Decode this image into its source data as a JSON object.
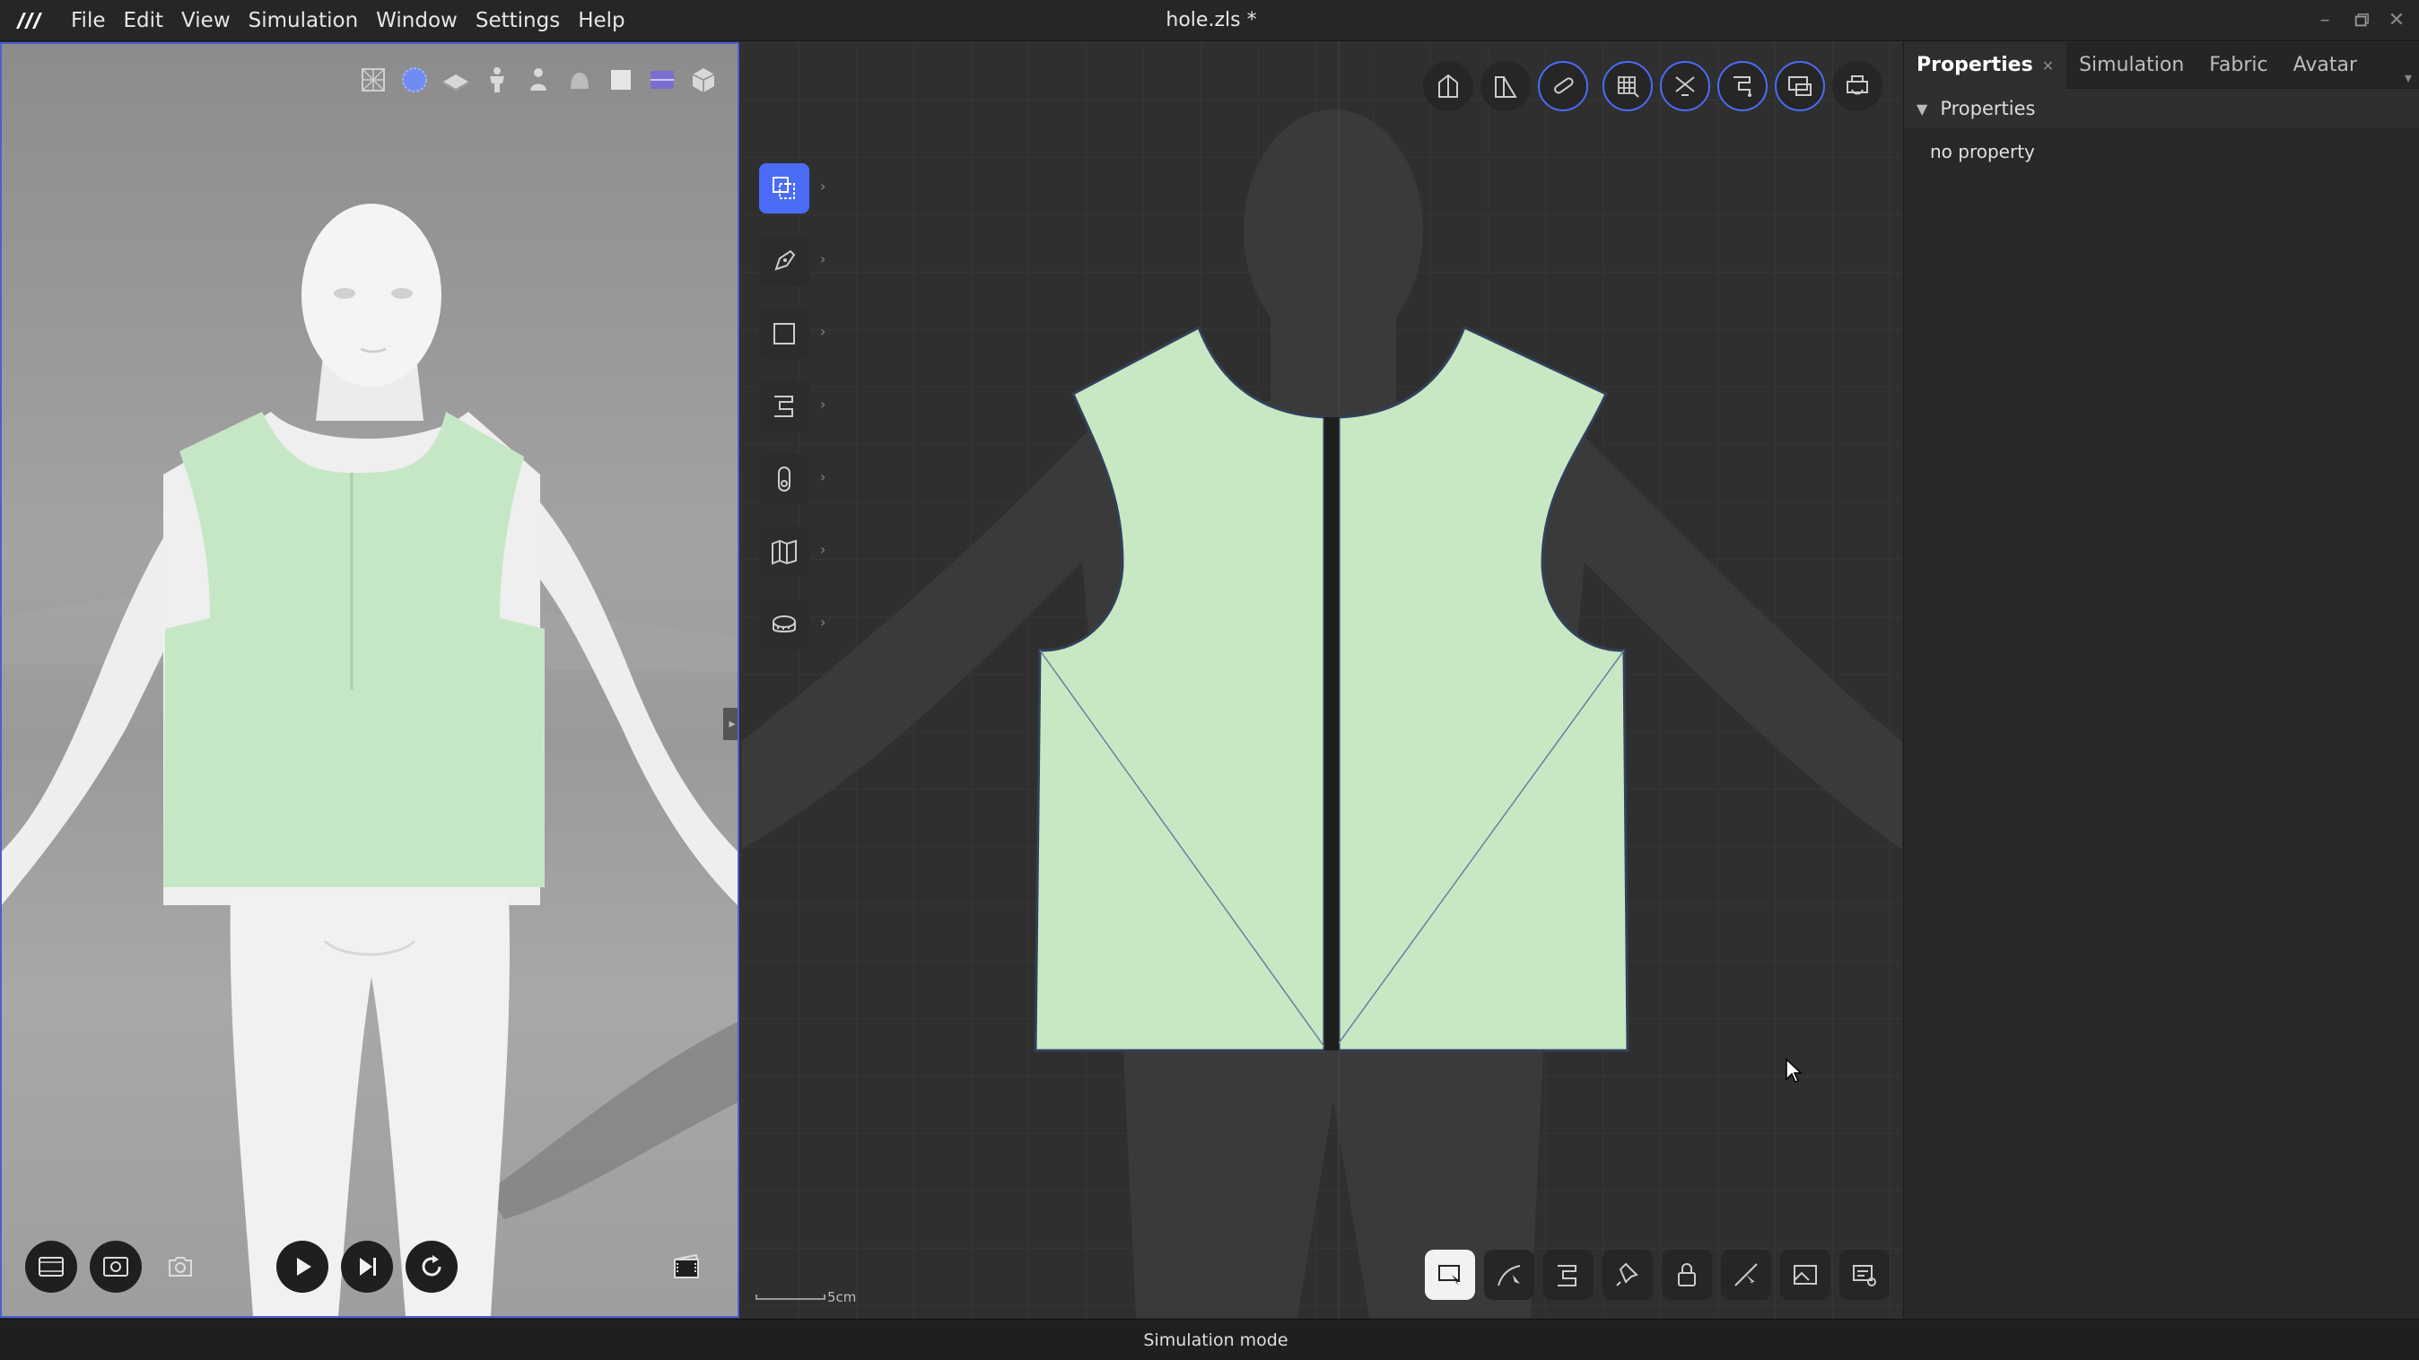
{
  "app": {
    "logo_icon": "clo-logo-icon",
    "title": "hole.zls *",
    "menu": [
      "File",
      "Edit",
      "View",
      "Simulation",
      "Window",
      "Settings",
      "Help"
    ],
    "window_controls": [
      "minimize-icon",
      "maximize-icon",
      "close-icon"
    ]
  },
  "viewport3d": {
    "toolbar_icons": [
      "wireframe-icon",
      "fabric-sphere-icon",
      "floor-icon",
      "avatar-icon",
      "avatar-silhouette-icon",
      "garment-icon",
      "cube-icon",
      "texture-icon",
      "box-3d-icon"
    ],
    "bottom_controls": [
      "render-icon",
      "snapshot-view-icon",
      "camera-icon",
      "play-icon",
      "step-forward-icon",
      "reset-icon",
      "video-icon"
    ],
    "garment_color": "#c6e7c6",
    "avatar_color": "#f0f0f0",
    "border_color": "#4a5fd6"
  },
  "pattern2d": {
    "side_tools": [
      "select-move-icon",
      "pen-icon",
      "rectangle-icon",
      "sewing-icon",
      "zipper-icon",
      "fold-icon",
      "measure-icon"
    ],
    "top_tools": [
      "pattern-house-icon",
      "pattern-edit-icon",
      "tape-icon",
      "grid-icon",
      "trim-icon",
      "sew-display-icon",
      "screen-icon",
      "printer-icon"
    ],
    "top_tools_highlighted": [
      2,
      3,
      4,
      5,
      6
    ],
    "bottom_tools": [
      "transform-icon",
      "curve-icon",
      "segment-icon",
      "pin-icon",
      "lock-icon",
      "edit-point-icon",
      "image-icon",
      "options-icon"
    ],
    "scale_label": "5cm",
    "pattern_fill": "#c8e8c4",
    "accent_color": "#4a6cf7"
  },
  "right_panel": {
    "tabs": [
      "Properties",
      "Simulation",
      "Fabric",
      "Avatar"
    ],
    "active_tab": "Properties",
    "section_title": "Properties",
    "empty_text": "no property"
  },
  "status": {
    "mode": "Simulation mode"
  }
}
